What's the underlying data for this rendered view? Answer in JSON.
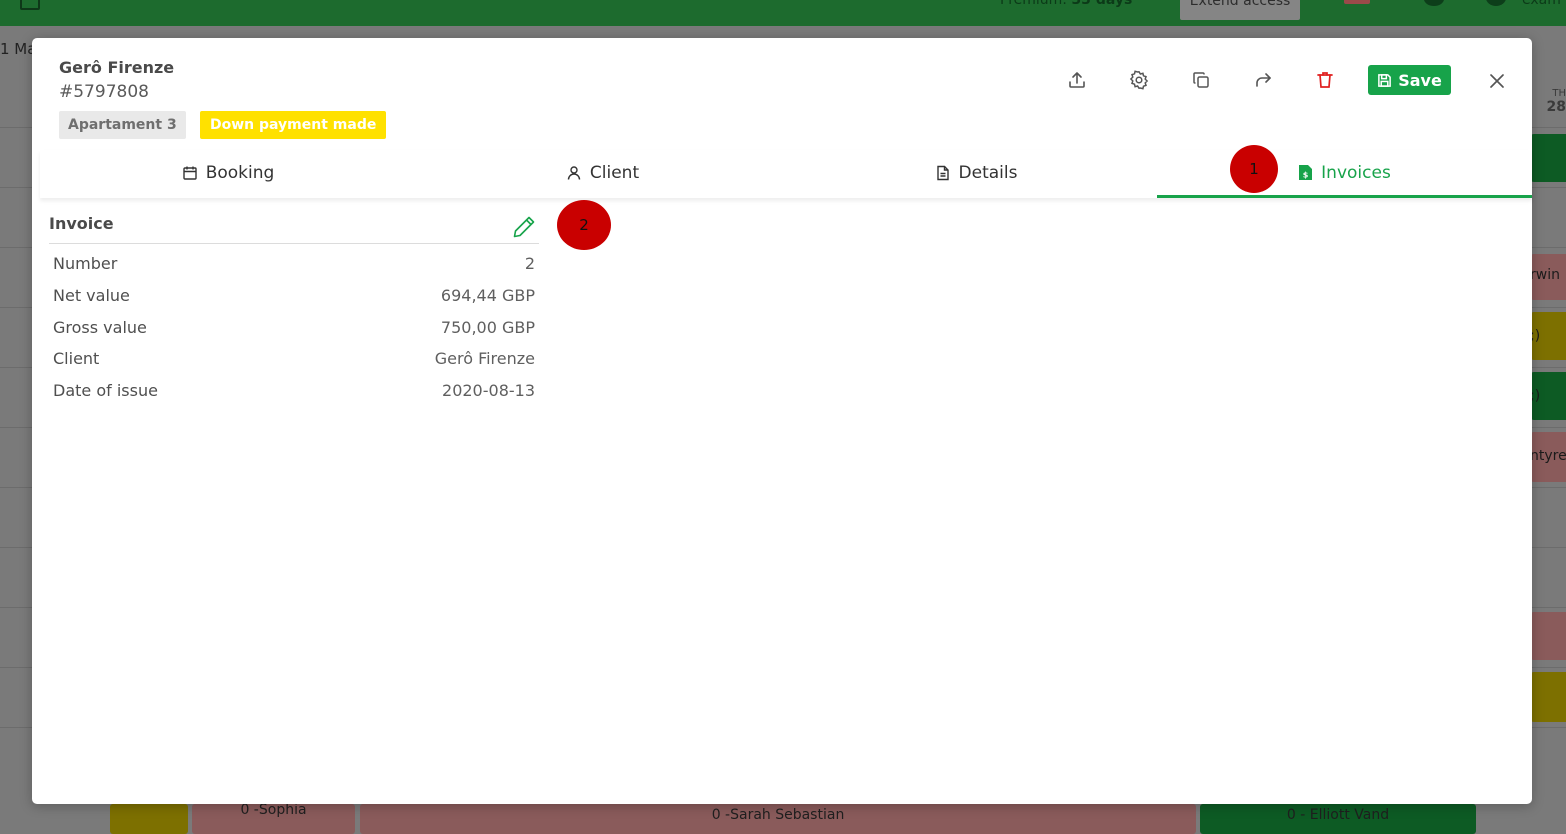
{
  "background": {
    "premium_label": "Premium: ",
    "premium_days": "33 days",
    "extend_access": "Extend access",
    "username": "exam",
    "month_label": "1 Ma",
    "side_header_top": "TH",
    "side_header_num": "28",
    "side_cells": [
      "",
      "rwin",
      ";)",
      ";)",
      "ntyre",
      "",
      ""
    ],
    "bottom_cells": [
      "",
      "0 -Sophia",
      "0 -Sarah Sebastian",
      "0 - Elliott Vand"
    ]
  },
  "booking": {
    "client_name": "Gerô Firenze",
    "booking_id": "#5797808",
    "room_tag": "Apartament 3",
    "status_tag": "Down payment made"
  },
  "toolbar": {
    "export_icon": "upload-icon",
    "settings_icon": "gear-icon",
    "copy_icon": "copy-icon",
    "share_icon": "forward-arrow-icon",
    "delete_icon": "trash-icon",
    "save_label": "Save",
    "close_icon": "close-icon",
    "delete_color": "#e02020",
    "accent_color": "#17a34a"
  },
  "tabs": [
    {
      "label": "Booking",
      "icon": "calendar-icon"
    },
    {
      "label": "Client",
      "icon": "user-icon"
    },
    {
      "label": "Details",
      "icon": "document-icon"
    },
    {
      "label": "Invoices",
      "icon": "invoice-icon",
      "active": true
    }
  ],
  "annotations": [
    "1",
    "2"
  ],
  "invoice": {
    "title": "Invoice",
    "rows": [
      {
        "label": "Number",
        "value": "2"
      },
      {
        "label": "Net value",
        "value": "694,44 GBP"
      },
      {
        "label": "Gross value",
        "value": "750,00 GBP"
      },
      {
        "label": "Client",
        "value": "Gerô Firenze"
      },
      {
        "label": "Date of issue",
        "value": "2020-08-13"
      }
    ]
  }
}
